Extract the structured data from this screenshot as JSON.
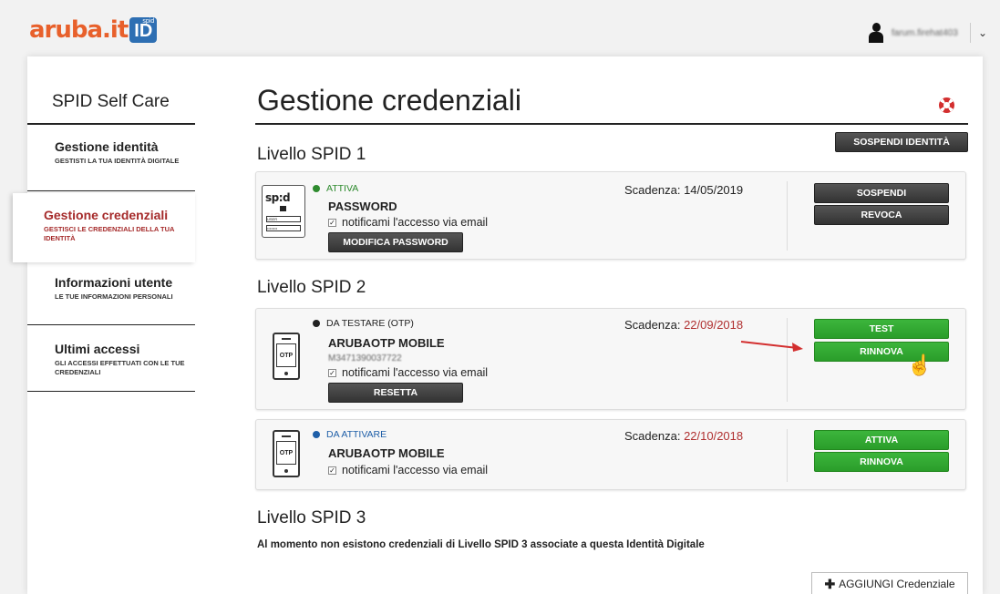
{
  "header": {
    "logo_text": "aruba.it",
    "logo_badge": "ID",
    "logo_badge_sup": "spid",
    "user_name": "farum.firehat403"
  },
  "sidebar": {
    "title": "SPID Self Care",
    "items": [
      {
        "label": "Gestione identità",
        "sub": "GESTISTI LA TUA IDENTITÀ DIGITALE",
        "active": false
      },
      {
        "label": "Gestione credenziali",
        "sub": "GESTISCI LE CREDENZIALI DELLA TUA IDENTITÀ",
        "active": true
      },
      {
        "label": "Informazioni utente",
        "sub": "LE TUE INFORMAZIONI PERSONALI",
        "active": false
      },
      {
        "label": "Ultimi accessi",
        "sub": "GLI ACCESSI EFFETTUATI CON LE TUE CREDENZIALI",
        "active": false
      }
    ]
  },
  "main": {
    "title": "Gestione credenziali",
    "suspend_identity_label": "SOSPENDI IDENTITÀ",
    "level1": {
      "title": "Livello SPID 1",
      "cred": {
        "status": "ATTIVA",
        "status_color": "#2e8b2e",
        "name": "PASSWORD",
        "notify": "notificami l'accesso via email",
        "action": "MODIFICA PASSWORD",
        "expiry_label": "Scadenza:",
        "expiry_date": "14/05/2019",
        "btn1": "SOSPENDI",
        "btn2": "REVOCA",
        "icon_text": "sp:d",
        "icon_field1": "USER",
        "icon_field2": "••••••••"
      }
    },
    "level2": {
      "title": "Livello SPID 2",
      "creds": [
        {
          "status": "DA TESTARE (OTP)",
          "status_color": "#222222",
          "name": "ARUBAOTP MOBILE",
          "sub": "M3471390037722",
          "notify": "notificami l'accesso via email",
          "action": "RESETTA",
          "expiry_label": "Scadenza:",
          "expiry_date": "22/09/2018",
          "btn1": "TEST",
          "btn2": "RINNOVA",
          "icon_text": "OTP"
        },
        {
          "status": "DA ATTIVARE",
          "status_color": "#1f5fa8",
          "name": "ARUBAOTP MOBILE",
          "notify": "notificami l'accesso via email",
          "expiry_label": "Scadenza:",
          "expiry_date": "22/10/2018",
          "btn1": "ATTIVA",
          "btn2": "RINNOVA",
          "icon_text": "OTP"
        }
      ]
    },
    "level3": {
      "title": "Livello SPID 3",
      "text": "Al momento non esistono credenziali di Livello SPID 3 associate a questa Identità Digitale"
    },
    "add_label": "AGGIUNGI Credenziale"
  }
}
